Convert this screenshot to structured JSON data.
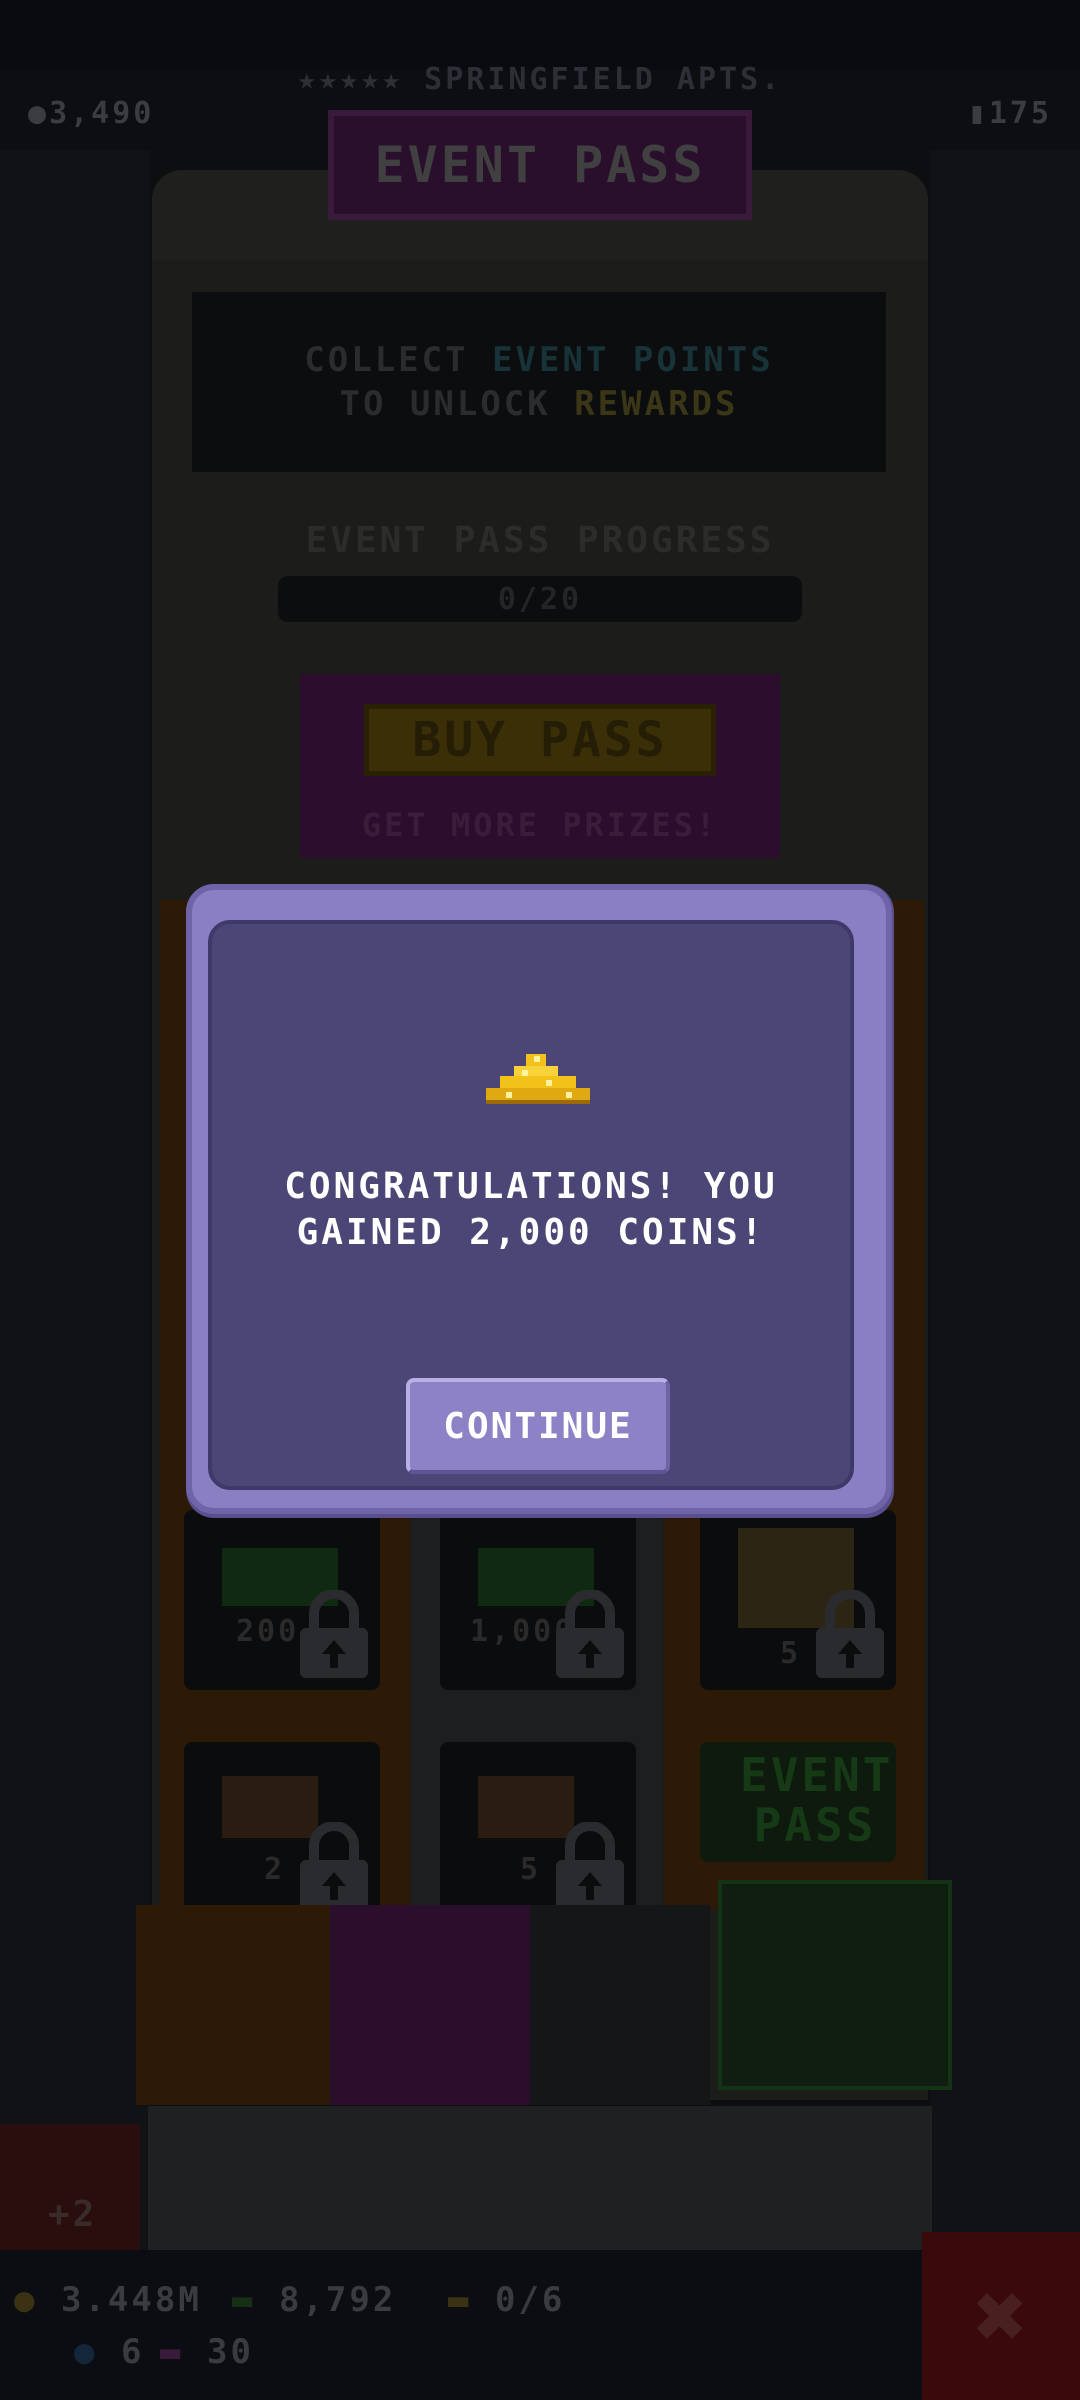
{
  "background": {
    "building_title": "SPRINGFIELD APTS.",
    "rating_stars": "★★★★★",
    "left_stat": "3,490",
    "right_stat": "175",
    "event_pass_banner": "EVENT PASS",
    "info": {
      "line1_a": "COLLECT ",
      "line1_b": "EVENT POINTS",
      "line2_a": "TO UNLOCK ",
      "line2_b": "REWARDS"
    },
    "progress_title": "EVENT PASS PROGRESS",
    "progress_text": "0/20",
    "buy_pass_label": "BUY PASS",
    "buy_pass_sub": "GET MORE PRIZES!",
    "reward_tiles": [
      {
        "label": "200"
      },
      {
        "label": "1,000"
      },
      {
        "label": "5"
      },
      {
        "label": "2"
      },
      {
        "label": "5"
      }
    ],
    "event_pass_side_label_1": "EVENT",
    "event_pass_side_label_2": "PASS",
    "side_counter": "+2"
  },
  "hud": {
    "coins": "3.448M",
    "bux": "8,792",
    "tickets": "0/6",
    "gems": "6",
    "tv": "30",
    "close_label": "✖"
  },
  "modal": {
    "message_line1": "CONGRATULATIONS! YOU",
    "message_line2": "GAINED 2,000 COINS!",
    "continue_label": "CONTINUE",
    "icon": "gold-coins-pile-icon"
  },
  "colors": {
    "modal_outer": "#8a7fc2",
    "modal_inner": "#4b4676",
    "button": "#8d82c6",
    "coin_gold": "#f2c21b"
  }
}
